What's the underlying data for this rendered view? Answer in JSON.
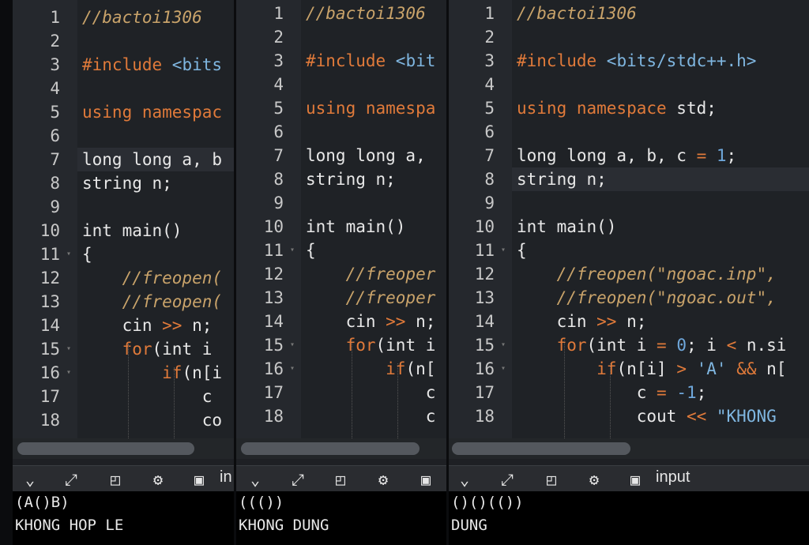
{
  "panels": [
    {
      "lines": [
        {
          "n": "1",
          "t": [
            [
              "cmt",
              "//bactoi1306"
            ]
          ]
        },
        {
          "n": "2",
          "t": []
        },
        {
          "n": "3",
          "t": [
            [
              "kw",
              "#include "
            ],
            [
              "str",
              "<bits"
            ]
          ]
        },
        {
          "n": "4",
          "t": []
        },
        {
          "n": "5",
          "t": [
            [
              "kw",
              "using namespac"
            ]
          ]
        },
        {
          "n": "6",
          "t": []
        },
        {
          "n": "7",
          "t": [
            [
              "",
              "long long a, b"
            ]
          ],
          "hl": true
        },
        {
          "n": "8",
          "t": [
            [
              "",
              "string n;"
            ]
          ]
        },
        {
          "n": "9",
          "t": []
        },
        {
          "n": "10",
          "t": [
            [
              "",
              "int main()"
            ]
          ]
        },
        {
          "n": "11",
          "t": [
            [
              "",
              "{"
            ]
          ],
          "fold": true
        },
        {
          "n": "12",
          "t": [
            [
              "",
              "    "
            ],
            [
              "cmt",
              "//freopen("
            ]
          ]
        },
        {
          "n": "13",
          "t": [
            [
              "",
              "    "
            ],
            [
              "cmt",
              "//freopen("
            ]
          ]
        },
        {
          "n": "14",
          "t": [
            [
              "",
              "    cin "
            ],
            [
              "op",
              ">>"
            ],
            [
              "",
              "",
              " n;"
            ]
          ]
        },
        {
          "n": "15",
          "t": [
            [
              "",
              "    "
            ],
            [
              "kw",
              "for"
            ],
            [
              "",
              "(int i"
            ]
          ],
          "fold": true
        },
        {
          "n": "16",
          "t": [
            [
              "",
              "        "
            ],
            [
              "kw",
              "if"
            ],
            [
              "",
              "(n[i"
            ]
          ],
          "fold": true
        },
        {
          "n": "17",
          "t": [
            [
              "",
              "            c"
            ]
          ]
        },
        {
          "n": "18",
          "t": [
            [
              "",
              "            co"
            ]
          ]
        }
      ],
      "toolbar": {
        "label": "in"
      },
      "output": [
        "(A()B)",
        "KHONG HOP LE"
      ]
    },
    {
      "lines": [
        {
          "n": "1",
          "t": [
            [
              "cmt",
              "//bactoi1306"
            ]
          ]
        },
        {
          "n": "2",
          "t": []
        },
        {
          "n": "3",
          "t": [
            [
              "kw",
              "#include "
            ],
            [
              "str",
              "<bit"
            ]
          ]
        },
        {
          "n": "4",
          "t": []
        },
        {
          "n": "5",
          "t": [
            [
              "kw",
              "using namespa"
            ]
          ]
        },
        {
          "n": "6",
          "t": []
        },
        {
          "n": "7",
          "t": [
            [
              "",
              "long long a,"
            ]
          ]
        },
        {
          "n": "8",
          "t": [
            [
              "",
              "string n;"
            ]
          ]
        },
        {
          "n": "9",
          "t": []
        },
        {
          "n": "10",
          "t": [
            [
              "",
              "int main()"
            ]
          ]
        },
        {
          "n": "11",
          "t": [
            [
              "",
              "{"
            ]
          ],
          "fold": true
        },
        {
          "n": "12",
          "t": [
            [
              "",
              "    "
            ],
            [
              "cmt",
              "//freoper"
            ]
          ]
        },
        {
          "n": "13",
          "t": [
            [
              "",
              "    "
            ],
            [
              "cmt",
              "//freoper"
            ]
          ]
        },
        {
          "n": "14",
          "t": [
            [
              "",
              "    cin "
            ],
            [
              "op",
              ">>"
            ],
            [
              "",
              " n;"
            ]
          ]
        },
        {
          "n": "15",
          "t": [
            [
              "",
              "    "
            ],
            [
              "kw",
              "for"
            ],
            [
              "",
              "(int i"
            ]
          ],
          "fold": true
        },
        {
          "n": "16",
          "t": [
            [
              "",
              "        "
            ],
            [
              "kw",
              "if"
            ],
            [
              "",
              "(n["
            ]
          ],
          "fold": true
        },
        {
          "n": "17",
          "t": [
            [
              "",
              "            c"
            ]
          ]
        },
        {
          "n": "18",
          "t": [
            [
              "",
              "            c"
            ]
          ]
        }
      ],
      "toolbar": {
        "label": ""
      },
      "output": [
        "((()) ",
        "KHONG DUNG"
      ]
    },
    {
      "lines": [
        {
          "n": "1",
          "t": [
            [
              "cmt",
              "//bactoi1306"
            ]
          ]
        },
        {
          "n": "2",
          "t": []
        },
        {
          "n": "3",
          "t": [
            [
              "kw",
              "#include "
            ],
            [
              "str",
              "<bits/stdc++.h>"
            ]
          ]
        },
        {
          "n": "4",
          "t": []
        },
        {
          "n": "5",
          "t": [
            [
              "kw",
              "using namespace "
            ],
            [
              "",
              "std;"
            ]
          ]
        },
        {
          "n": "6",
          "t": []
        },
        {
          "n": "7",
          "t": [
            [
              "",
              "long long a, b, c "
            ],
            [
              "op",
              "="
            ],
            [
              "num",
              " 1"
            ],
            [
              "",
              ";"
            ]
          ]
        },
        {
          "n": "8",
          "t": [
            [
              "",
              "string n;"
            ]
          ],
          "hl": true
        },
        {
          "n": "9",
          "t": []
        },
        {
          "n": "10",
          "t": [
            [
              "",
              "int main()"
            ]
          ]
        },
        {
          "n": "11",
          "t": [
            [
              "",
              "{"
            ]
          ],
          "fold": true
        },
        {
          "n": "12",
          "t": [
            [
              "",
              "    "
            ],
            [
              "cmt",
              "//freopen(\"ngoac.inp\","
            ]
          ]
        },
        {
          "n": "13",
          "t": [
            [
              "",
              "    "
            ],
            [
              "cmt",
              "//freopen(\"ngoac.out\","
            ]
          ]
        },
        {
          "n": "14",
          "t": [
            [
              "",
              "    cin "
            ],
            [
              "op",
              ">>"
            ],
            [
              "",
              " n;"
            ]
          ]
        },
        {
          "n": "15",
          "t": [
            [
              "",
              "    "
            ],
            [
              "kw",
              "for"
            ],
            [
              "",
              "(int i "
            ],
            [
              "op",
              "="
            ],
            [
              "num",
              " 0"
            ],
            [
              "",
              "; i "
            ],
            [
              "op",
              "<"
            ],
            [
              "",
              " n.si"
            ]
          ],
          "fold": true
        },
        {
          "n": "16",
          "t": [
            [
              "",
              "        "
            ],
            [
              "kw",
              "if"
            ],
            [
              "",
              "(n[i] "
            ],
            [
              "op",
              ">"
            ],
            [
              "str",
              " 'A'"
            ],
            [
              "op",
              " &&"
            ],
            [
              "",
              " n["
            ]
          ],
          "fold": true
        },
        {
          "n": "17",
          "t": [
            [
              "",
              "            c "
            ],
            [
              "op",
              "="
            ],
            [
              "num",
              " -1"
            ],
            [
              "",
              ";"
            ]
          ]
        },
        {
          "n": "18",
          "t": [
            [
              "",
              "            cout "
            ],
            [
              "op",
              "<<"
            ],
            [
              "str",
              " \"KHONG"
            ]
          ]
        }
      ],
      "toolbar": {
        "label": "input"
      },
      "output": [
        "()()(()) ",
        "DUNG"
      ]
    }
  ],
  "icons": [
    "chevron-down-icon",
    "expand-icon",
    "layout-icon",
    "gear-icon",
    "paste-icon"
  ]
}
